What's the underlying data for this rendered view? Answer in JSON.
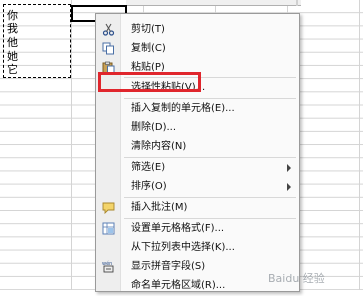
{
  "sheet": {
    "cells_column_a": [
      "你",
      "我",
      "他",
      "她",
      "它"
    ]
  },
  "context_menu": {
    "items": [
      {
        "label": "剪切(T)",
        "icon": "scissors-icon"
      },
      {
        "label": "复制(C)",
        "icon": "copy-icon"
      },
      {
        "label": "粘贴(P)",
        "icon": "paste-icon"
      },
      {
        "label": "选择性粘贴(V)...",
        "icon": ""
      },
      {
        "label": "插入复制的单元格(E)...",
        "icon": ""
      },
      {
        "label": "删除(D)...",
        "icon": ""
      },
      {
        "label": "清除内容(N)",
        "icon": ""
      },
      {
        "label": "筛选(E)",
        "icon": "",
        "submenu": true
      },
      {
        "label": "排序(O)",
        "icon": "",
        "submenu": true
      },
      {
        "label": "插入批注(M)",
        "icon": "comment-icon"
      },
      {
        "label": "设置单元格格式(F)...",
        "icon": "format-cells-icon"
      },
      {
        "label": "从下拉列表中选择(K)...",
        "icon": ""
      },
      {
        "label": "显示拼音字段(S)",
        "icon": "phonetic-icon"
      },
      {
        "label": "命名单元格区域(R)...",
        "icon": ""
      }
    ],
    "highlighted_item": "选择性粘贴(V)..."
  },
  "colors": {
    "highlight_border": "#e0262d"
  },
  "watermark": {
    "text": "Baidu 经验"
  }
}
